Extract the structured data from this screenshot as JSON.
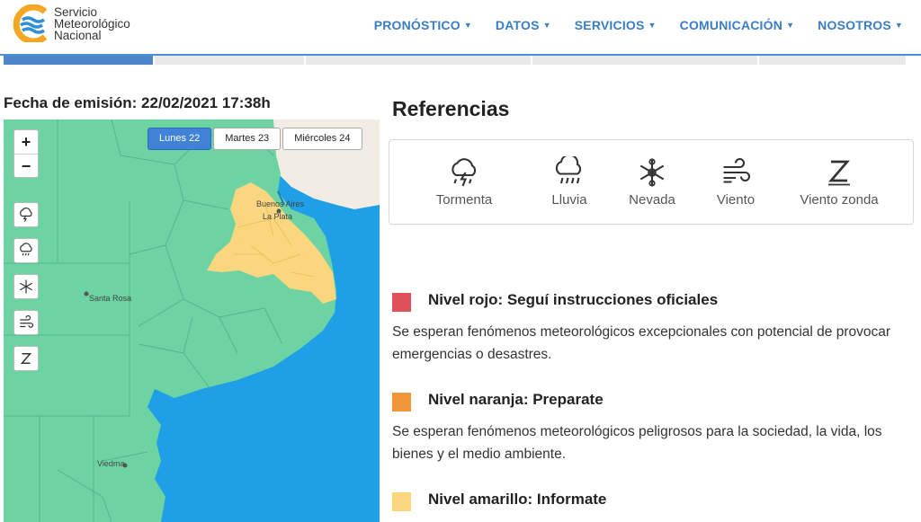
{
  "header": {
    "logo_lines": [
      "Servicio",
      "Meteorológico",
      "Nacional"
    ],
    "nav": [
      {
        "label": "PRONÓSTICO"
      },
      {
        "label": "DATOS"
      },
      {
        "label": "SERVICIOS"
      },
      {
        "label": "COMUNICACIÓN"
      },
      {
        "label": "NOSOTROS"
      }
    ]
  },
  "emission": "Fecha de emisión: 22/02/2021 17:38h",
  "map": {
    "zoom_in": "+",
    "zoom_out": "−",
    "day_tabs": [
      {
        "label": "Lunes 22",
        "active": true
      },
      {
        "label": "Martes 23",
        "active": false
      },
      {
        "label": "Miércoles 24",
        "active": false
      }
    ],
    "places": {
      "buenos_aires": "Buenos Aires",
      "la_plata": "La Plata",
      "santa_rosa": "Santa Rosa",
      "viedma": "Viedma"
    },
    "filters": [
      "storm-icon",
      "rain-icon",
      "snow-icon",
      "wind-icon",
      "zonda-wind-icon"
    ],
    "colors": {
      "sea": "#1fa0e6",
      "green_level": "#6dd3a3",
      "yellow_level": "#fad67e",
      "land": "#f1ede4"
    }
  },
  "references": {
    "title": "Referencias",
    "items": [
      {
        "label": "Tormenta",
        "icon": "storm-icon"
      },
      {
        "label": "Lluvia",
        "icon": "rain-icon"
      },
      {
        "label": "Nevada",
        "icon": "snow-icon"
      },
      {
        "label": "Viento",
        "icon": "wind-icon"
      },
      {
        "label": "Viento zonda",
        "icon": "zonda-wind-icon"
      }
    ]
  },
  "levels": [
    {
      "title": "Nivel rojo: Seguí instrucciones oficiales",
      "color": "#e0505b",
      "desc": "Se esperan fenómenos meteorológicos excepcionales con potencial de provocar emergencias o desastres."
    },
    {
      "title": "Nivel naranja: Preparate",
      "color": "#f2963c",
      "desc": "Se esperan fenómenos meteorológicos peligrosos para la sociedad, la vida, los bienes y el medio ambiente."
    },
    {
      "title": "Nivel amarillo: Informate",
      "color": "#fad67e",
      "desc": ""
    }
  ]
}
